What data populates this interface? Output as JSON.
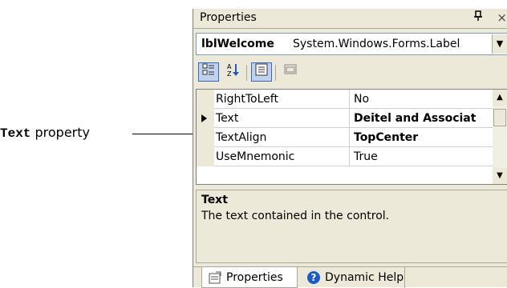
{
  "callout": {
    "mono_word": "Text",
    "rest": " property"
  },
  "panel": {
    "title": "Properties",
    "pin_glyph": "⊥",
    "close_glyph": "×"
  },
  "object_selector": {
    "name": "lblWelcome",
    "type": "System.Windows.Forms.Label"
  },
  "toolbar": {
    "categorized_icon": "categorized-icon",
    "alphabetical_icon": "alphabetical-icon",
    "properties_icon": "properties-icon",
    "property_pages_icon": "property-pages-icon"
  },
  "properties": [
    {
      "name": "RightToLeft",
      "value": "No",
      "bold": false
    },
    {
      "name": "Text",
      "value": "Deitel and Associat",
      "bold": true,
      "selected": true
    },
    {
      "name": "TextAlign",
      "value": "TopCenter",
      "bold": true
    },
    {
      "name": "UseMnemonic",
      "value": "True",
      "bold": false
    }
  ],
  "description": {
    "title": "Text",
    "text": "The text contained in the control."
  },
  "tabs": [
    {
      "label": "Properties",
      "active": true
    },
    {
      "label": "Dynamic Help",
      "active": false
    }
  ],
  "colors": {
    "panel_bg": "#ece9d8",
    "selection_border": "#316ac5",
    "help_blue": "#1a5bc6"
  }
}
